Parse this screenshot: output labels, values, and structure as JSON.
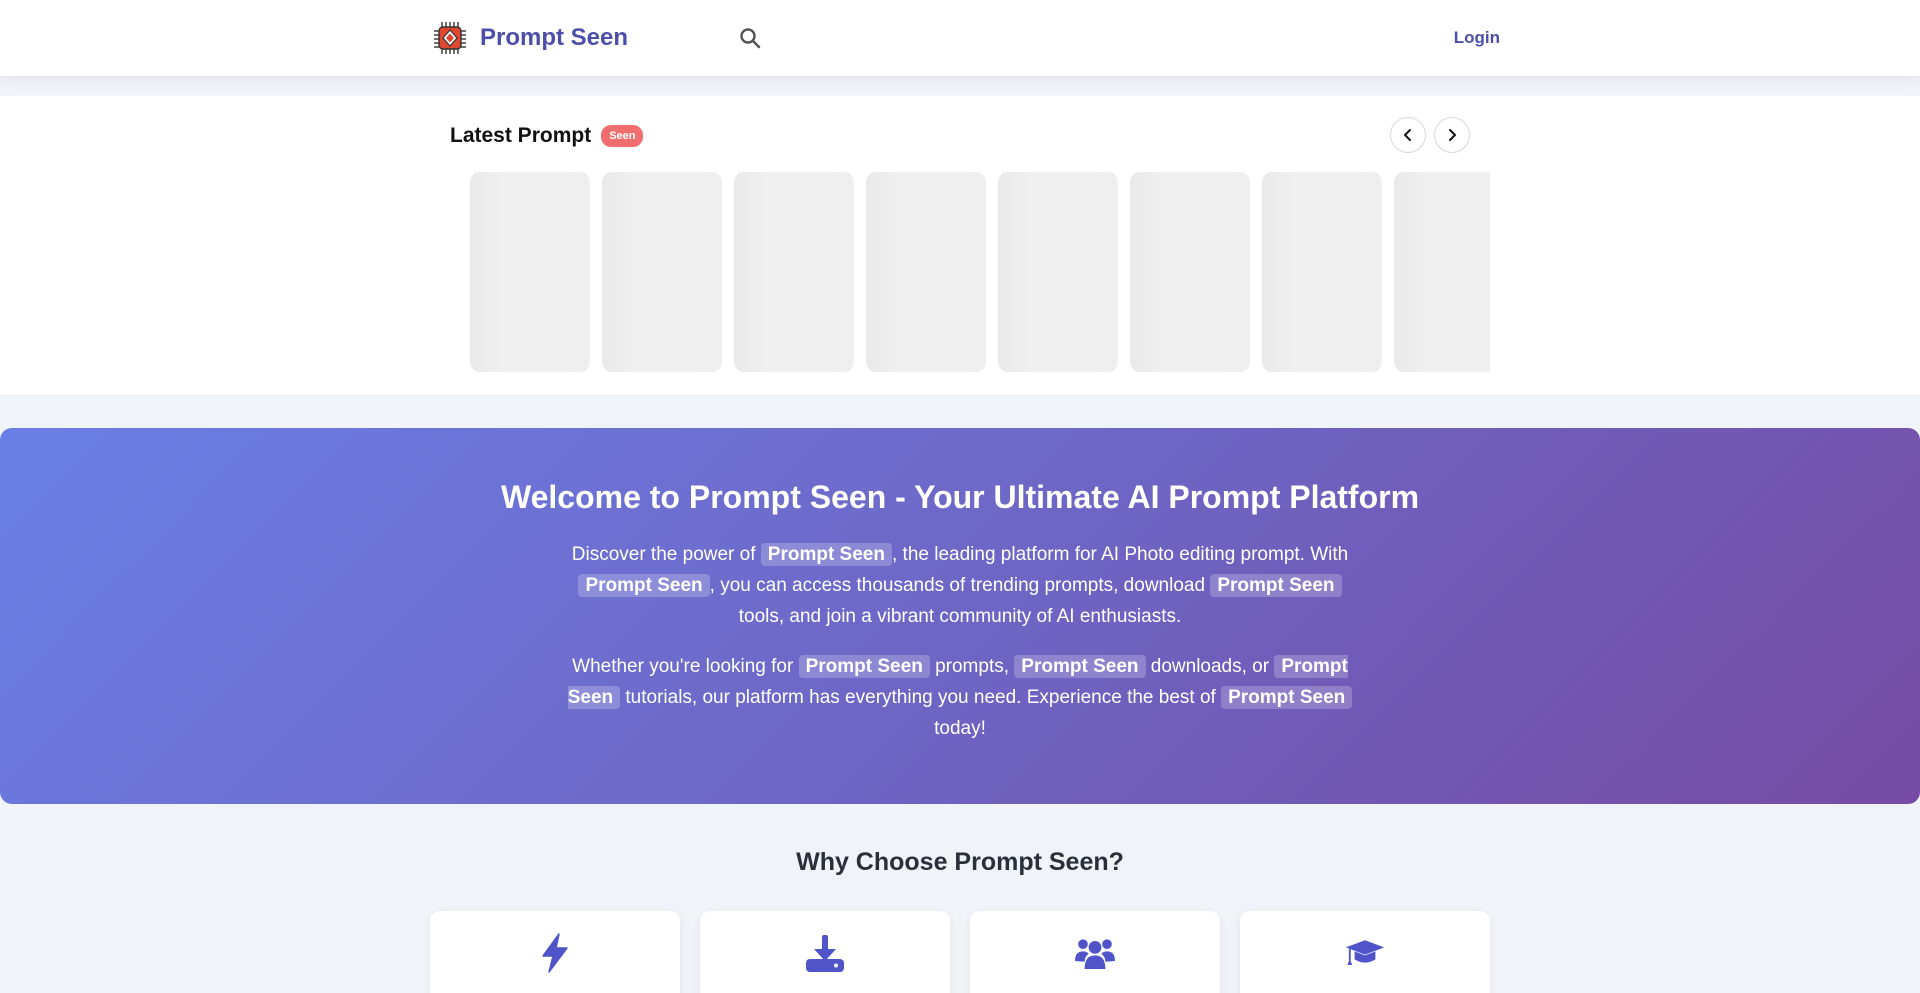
{
  "colors": {
    "brand": "#4c4fa8",
    "badge": "#f06e6e",
    "hero_start": "#6a7fe6",
    "hero_end": "#774ba4",
    "feature_icon": "#4f55c8"
  },
  "header": {
    "logo_icon": "chip-logo-icon",
    "brand_name": "Prompt Seen",
    "search_icon": "search-icon",
    "login_label": "Login"
  },
  "latest": {
    "title": "Latest Prompt",
    "badge": "Seen",
    "prev_icon": "chevron-left-icon",
    "next_icon": "chevron-right-icon",
    "card_count": 8
  },
  "hero": {
    "title": "Welcome to Prompt Seen - Your Ultimate AI Prompt Platform",
    "p1": {
      "t1": "Discover the power of ",
      "h1": "Prompt Seen",
      "t2": ", the leading platform for AI Photo editing prompt. With ",
      "h2": "Prompt Seen",
      "t3": ", you can access thousands of trending prompts, download ",
      "h3": "Prompt Seen",
      "t4": " tools, and join a vibrant community of AI enthusiasts."
    },
    "p2": {
      "t1": "Whether you're looking for ",
      "h1": "Prompt Seen",
      "t2": " prompts, ",
      "h2": "Prompt Seen",
      "t3": " downloads, or ",
      "h3": "Prompt Seen",
      "t4": " tutorials, our platform has everything you need. Experience the best of ",
      "h4": "Prompt Seen",
      "t5": " today!"
    }
  },
  "why": {
    "title": "Why Choose Prompt Seen?",
    "features": [
      {
        "icon": "lightning-bolt-icon"
      },
      {
        "icon": "download-icon"
      },
      {
        "icon": "users-icon"
      },
      {
        "icon": "graduation-cap-icon"
      }
    ]
  }
}
